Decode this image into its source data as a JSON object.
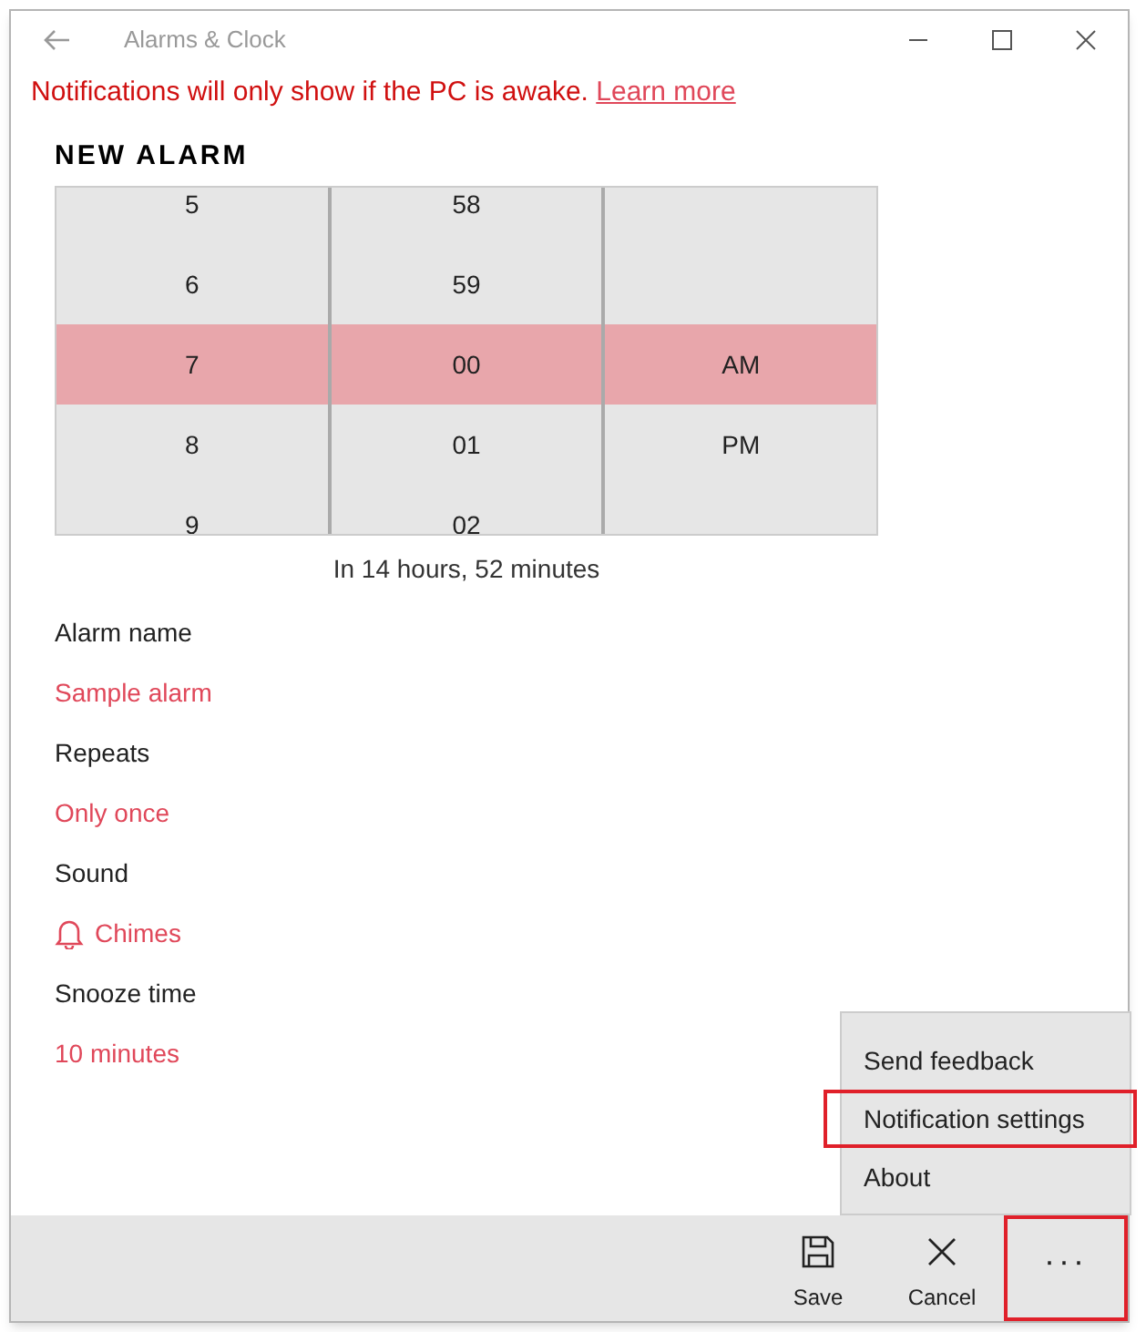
{
  "window": {
    "title": "Alarms & Clock"
  },
  "notice": {
    "text": "Notifications will only show if the PC is awake.",
    "link": "Learn more"
  },
  "heading": "NEW ALARM",
  "picker": {
    "columns": [
      {
        "items": [
          {
            "label": "5",
            "selected": false
          },
          {
            "label": "6",
            "selected": false
          },
          {
            "label": "7",
            "selected": true
          },
          {
            "label": "8",
            "selected": false
          },
          {
            "label": "9",
            "selected": false
          }
        ]
      },
      {
        "items": [
          {
            "label": "58",
            "selected": false
          },
          {
            "label": "59",
            "selected": false
          },
          {
            "label": "00",
            "selected": true
          },
          {
            "label": "01",
            "selected": false
          },
          {
            "label": "02",
            "selected": false
          }
        ]
      },
      {
        "items": [
          {
            "label": "AM",
            "selected": true
          },
          {
            "label": "PM",
            "selected": false
          }
        ]
      }
    ],
    "caption": "In 14 hours, 52 minutes"
  },
  "fields": [
    {
      "label": "Alarm name",
      "value": "Sample alarm",
      "kind": "text"
    },
    {
      "label": "Repeats",
      "value": "Only once",
      "kind": "text"
    },
    {
      "label": "Sound",
      "value": "Chimes",
      "kind": "sound"
    },
    {
      "label": "Snooze time",
      "value": "10 minutes",
      "kind": "text"
    }
  ],
  "menu": [
    {
      "label": "Send feedback",
      "highlighted": false
    },
    {
      "label": "Notification settings",
      "highlighted": true
    },
    {
      "label": "About",
      "highlighted": false
    }
  ],
  "command_bar": [
    {
      "label": "Save",
      "kind": "save",
      "highlighted": false
    },
    {
      "label": "Cancel",
      "kind": "cancel",
      "highlighted": false
    },
    {
      "label": "···",
      "kind": "more",
      "highlighted": true
    }
  ]
}
